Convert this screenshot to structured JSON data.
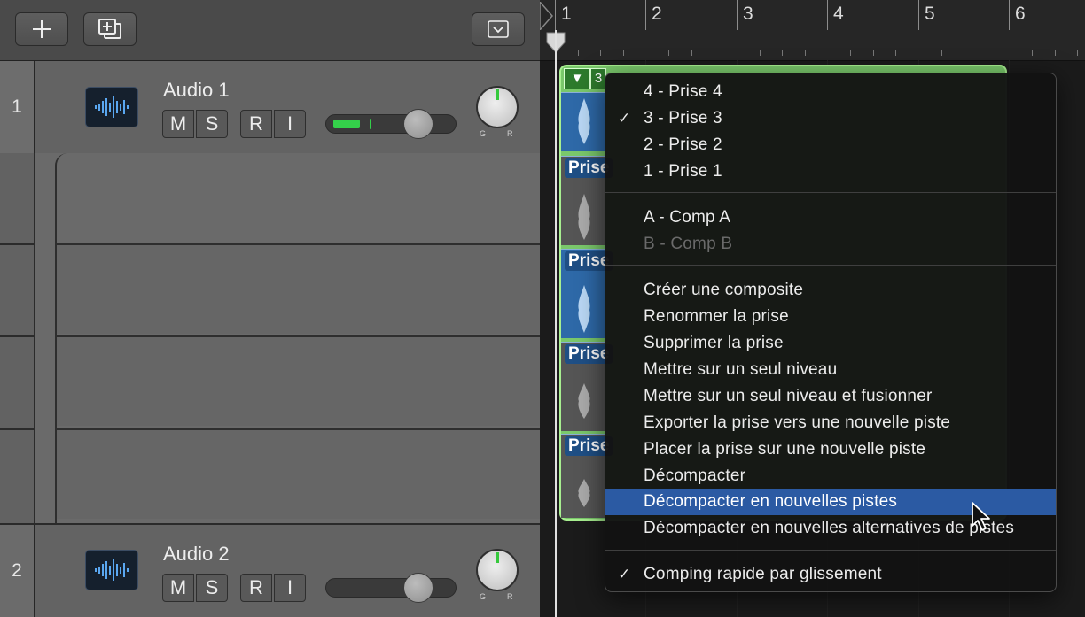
{
  "toolbar": {
    "add_icon": "plus-icon",
    "add_track_icon": "duplicate-track-icon",
    "dropdown_icon": "chevron-down-icon"
  },
  "tracks": [
    {
      "number": "1",
      "name": "Audio 1",
      "m": "M",
      "s": "S",
      "r": "R",
      "i": "I",
      "g": "G",
      "rr": "R"
    },
    {
      "number": "2",
      "name": "Audio 2",
      "m": "M",
      "s": "S",
      "r": "R",
      "i": "I",
      "g": "G",
      "rr": "R"
    }
  ],
  "ruler": {
    "bars": [
      "1",
      "2",
      "3",
      "4",
      "5",
      "6"
    ]
  },
  "takes": {
    "collapse_glyph": "▼",
    "label": "Prise",
    "header_number": "3"
  },
  "menu": {
    "takes": [
      {
        "label": "4 - Prise 4",
        "checked": false
      },
      {
        "label": "3 - Prise 3",
        "checked": true
      },
      {
        "label": "2 - Prise 2",
        "checked": false
      },
      {
        "label": "1 - Prise 1",
        "checked": false
      }
    ],
    "comps": [
      {
        "label": "A - Comp A",
        "disabled": false
      },
      {
        "label": "B - Comp B",
        "disabled": true
      }
    ],
    "actions": [
      "Créer une composite",
      "Renommer la prise",
      "Supprimer la prise",
      "Mettre sur un seul niveau",
      "Mettre sur un seul niveau et fusionner",
      "Exporter la prise vers une nouvelle piste",
      "Placer la prise sur une nouvelle piste",
      "Décompacter",
      "Décompacter en nouvelles pistes",
      "Décompacter en nouvelles alternatives de pistes"
    ],
    "highlighted": "Décompacter en nouvelles pistes",
    "footer": {
      "label": "Comping rapide par glissement",
      "checked": true
    },
    "check_glyph": "✓"
  },
  "colors": {
    "comp_green": "#7ac86b",
    "take_blue": "#2e69a8",
    "highlight": "#2b5aa3",
    "meter_green": "#34d04a"
  }
}
